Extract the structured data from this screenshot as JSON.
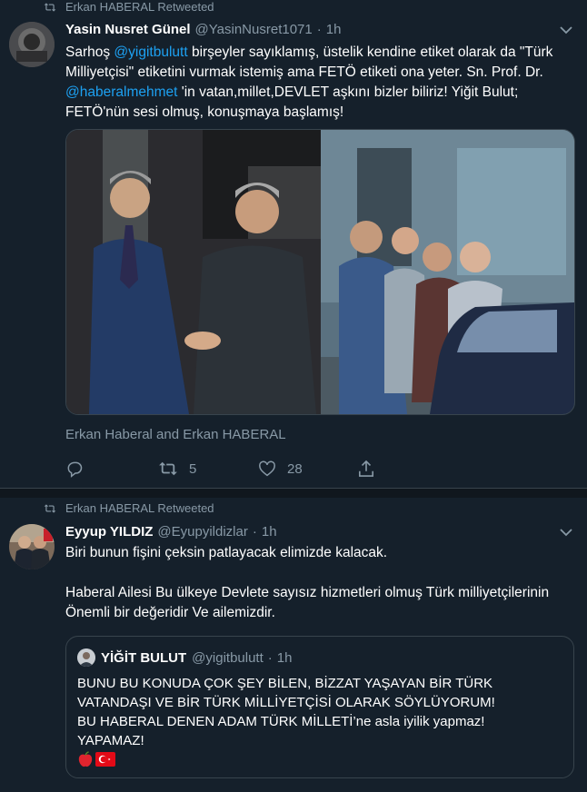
{
  "tweet1": {
    "retweeted_by": "Erkan HABERAL Retweeted",
    "name": "Yasin Nusret Günel",
    "handle": "@YasinNusret1071",
    "sep": "·",
    "time": "1h",
    "text_parts": {
      "a": "Sarhoş ",
      "mention1": "@yigitbulutt",
      "b": " birşeyler sayıklamış, üstelik kendine etiket olarak da \"Türk Milliyetçisi\" etiketini vurmak istemiş ama FETÖ etiketi ona yeter. Sn. Prof. Dr. ",
      "mention2": "@haberalmehmet",
      "c": " 'in vatan,millet,DEVLET aşkını bizler biliriz! Yiğit Bulut; FETÖ'nün sesi olmuş, konuşmaya başlamış!"
    },
    "tagged": "Erkan Haberal and Erkan HABERAL",
    "retweets": "5",
    "likes": "28"
  },
  "tweet2": {
    "retweeted_by": "Erkan HABERAL Retweeted",
    "name": "Eyyup YILDIZ",
    "handle": "@Eyupyildizlar",
    "sep": "·",
    "time": "1h",
    "line1": "Biri bunun fişini çeksin patlayacak elimizde kalacak.",
    "line2": "Haberal Ailesi Bu ülkeye Devlete sayısız hizmetleri olmuş Türk milliyetçilerinin Önemli bir değeridir Ve ailemizdir.",
    "quote": {
      "name": "YİĞİT BULUT",
      "handle": "@yigitbulutt",
      "sep": "·",
      "time": "1h",
      "l1": "BUNU BU KONUDA ÇOK ŞEY BİLEN, BİZZAT YAŞAYAN BİR TÜRK",
      "l2": "VATANDAŞI VE BİR TÜRK MİLLİYETÇİSİ OLARAK SÖYLÜYORUM!",
      "l3": "BU HABERAL DENEN ADAM TÜRK MİLLETİ’ne asla iyilik yapmaz!",
      "l4": "YAPAMAZ!"
    }
  },
  "colors": {
    "background": "#15202b",
    "muted": "#8899a6",
    "link": "#1da1f2",
    "border": "#38444d"
  },
  "icons": [
    "retweet-icon",
    "chevron-down-icon",
    "reply-icon",
    "like-icon",
    "share-icon",
    "apple-emoji",
    "turkey-flag-emoji"
  ]
}
